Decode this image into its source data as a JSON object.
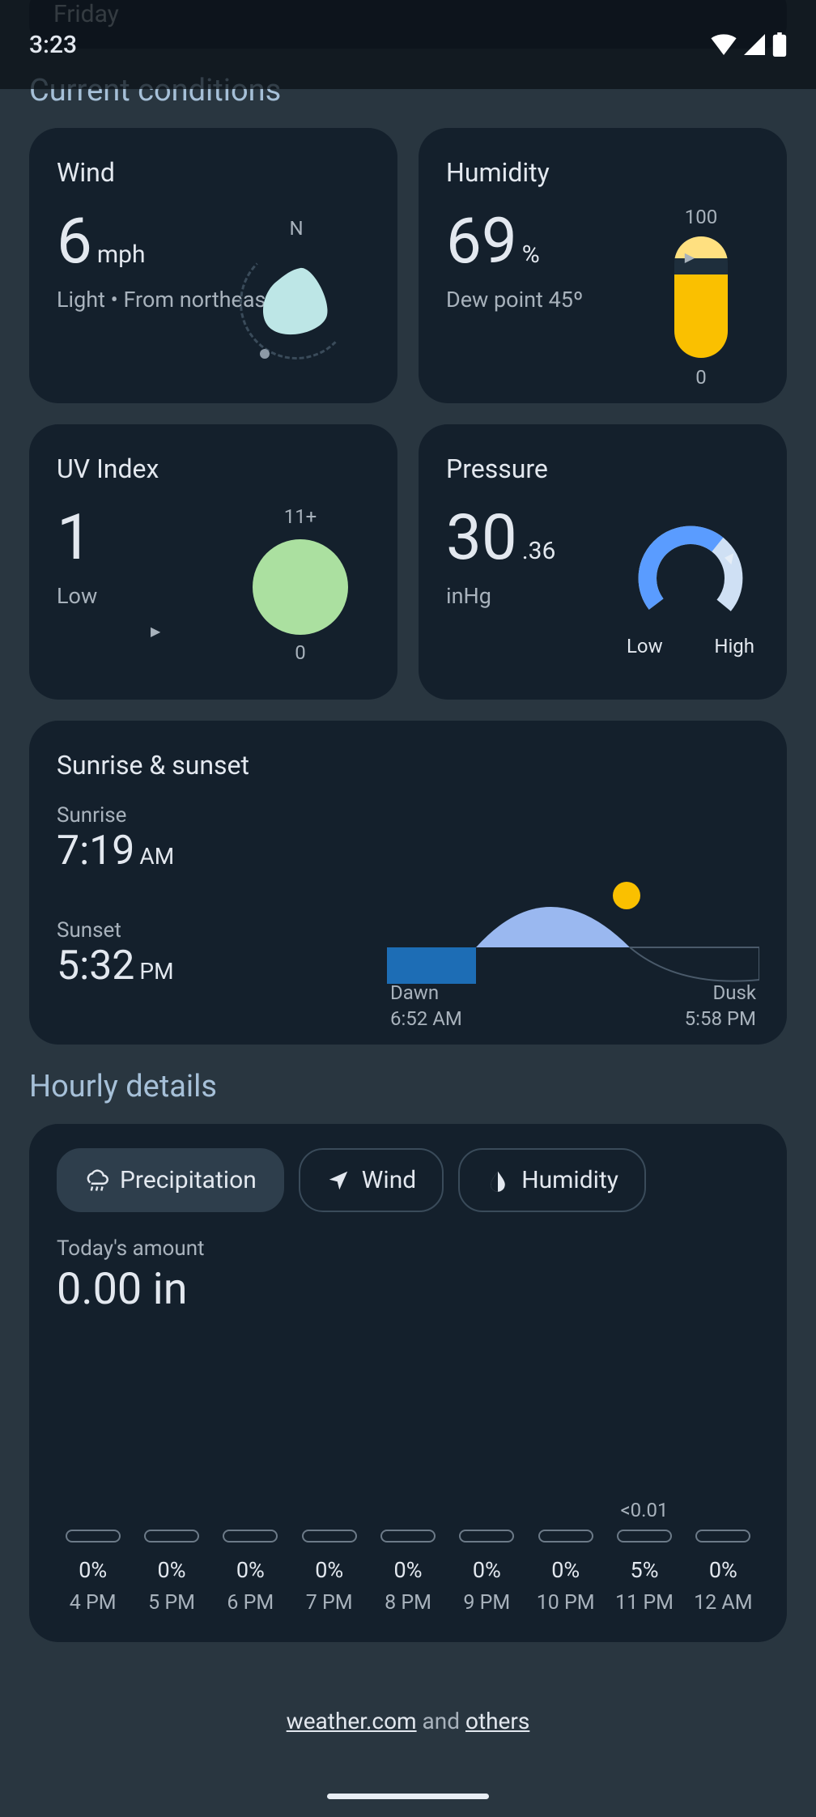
{
  "status": {
    "time": "3:23"
  },
  "ghost": {
    "day": "Friday"
  },
  "sections": {
    "current": "Current conditions",
    "hourly": "Hourly details"
  },
  "wind": {
    "title": "Wind",
    "value": "6",
    "unit": "mph",
    "desc": "Light • From northeast",
    "north": "N"
  },
  "humidity": {
    "title": "Humidity",
    "value": "69",
    "unit": "%",
    "dew": "Dew point 45º",
    "top": "100",
    "bottom": "0"
  },
  "uv": {
    "title": "UV Index",
    "value": "1",
    "desc": "Low",
    "top": "11+",
    "bottom": "0"
  },
  "pressure": {
    "title": "Pressure",
    "whole": "30",
    "frac": ".36",
    "unit": "inHg",
    "low": "Low",
    "high": "High"
  },
  "sun": {
    "title": "Sunrise & sunset",
    "sunrise_label": "Sunrise",
    "sunrise_time": "7:19",
    "sunrise_ampm": "AM",
    "sunset_label": "Sunset",
    "sunset_time": "5:32",
    "sunset_ampm": "PM",
    "dawn_label": "Dawn",
    "dawn_time": "6:52 AM",
    "dusk_label": "Dusk",
    "dusk_time": "5:58 PM"
  },
  "hourly": {
    "chips": {
      "precip": "Precipitation",
      "wind": "Wind",
      "humidity": "Humidity"
    },
    "today_label": "Today's amount",
    "today_value": "0.00 in",
    "annotation": "<0.01",
    "bars": [
      {
        "pct": "0%",
        "hr": "4 PM",
        "ann": ""
      },
      {
        "pct": "0%",
        "hr": "5 PM",
        "ann": ""
      },
      {
        "pct": "0%",
        "hr": "6 PM",
        "ann": ""
      },
      {
        "pct": "0%",
        "hr": "7 PM",
        "ann": ""
      },
      {
        "pct": "0%",
        "hr": "8 PM",
        "ann": ""
      },
      {
        "pct": "0%",
        "hr": "9 PM",
        "ann": ""
      },
      {
        "pct": "0%",
        "hr": "10 PM",
        "ann": ""
      },
      {
        "pct": "5%",
        "hr": "11 PM",
        "ann": "<0.01"
      },
      {
        "pct": "0%",
        "hr": "12 AM",
        "ann": ""
      }
    ]
  },
  "footer": {
    "src1": "weather.com",
    "mid": " and ",
    "src2": "others"
  }
}
